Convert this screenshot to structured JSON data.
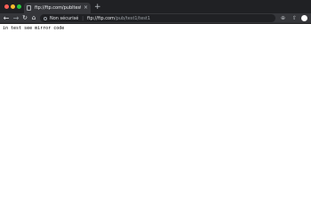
{
  "tab": {
    "title": "ftp://ftp.com/publtest1/test"
  },
  "omnibox": {
    "security_label": "Non sécurisé",
    "separator": "|",
    "url_host": "ftp://ftp.com",
    "url_path": "/pub/test1/test1"
  },
  "icons": {
    "back": "←",
    "forward": "→",
    "reload": "↻",
    "home": "⌂",
    "new_tab": "+",
    "tab_close": "×",
    "extension": "⊕",
    "upload": "⇧"
  },
  "page": {
    "body_text": "in test see mirror code"
  }
}
